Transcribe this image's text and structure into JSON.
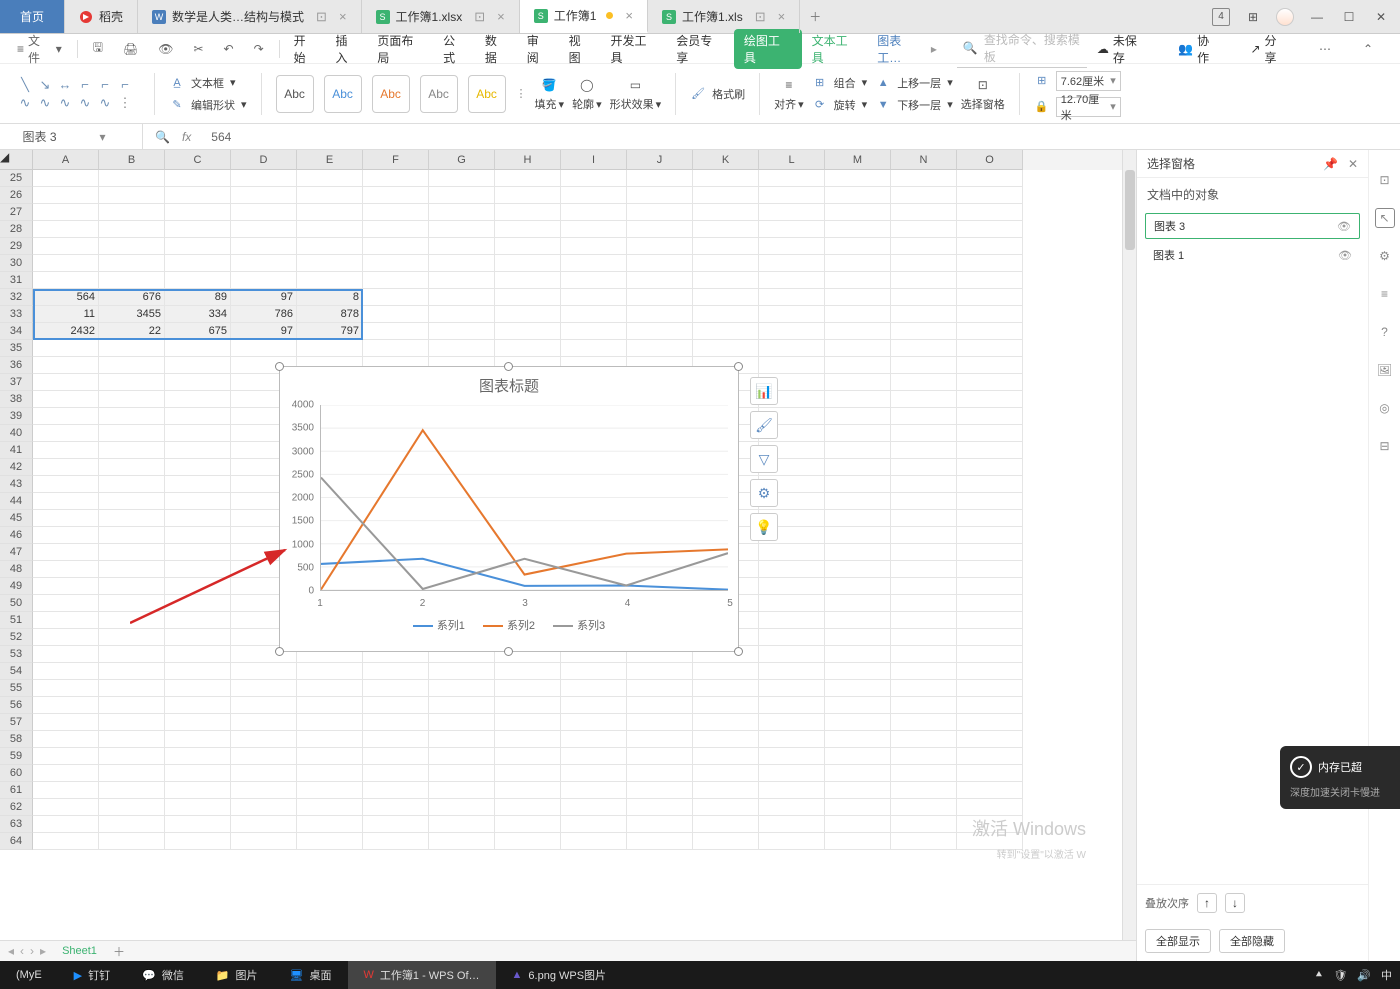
{
  "titlebar": {
    "home": "首页",
    "tabs": [
      {
        "icon": "doke",
        "label": "稻壳",
        "color": "#e53935"
      },
      {
        "icon": "W",
        "label": "数学是人类…结构与模式",
        "color": "#4a7ebb"
      },
      {
        "icon": "S",
        "label": "工作簿1.xlsx",
        "color": "#3cb371"
      },
      {
        "icon": "S",
        "label": "工作簿1",
        "color": "#3cb371",
        "active": true,
        "dirty": true
      },
      {
        "icon": "S",
        "label": "工作簿1.xls",
        "color": "#3cb371"
      }
    ],
    "add": "＋",
    "badge4": "4",
    "grid": "⊞"
  },
  "menubar": {
    "file": "文件",
    "tabs": [
      "开始",
      "插入",
      "页面布局",
      "公式",
      "数据",
      "审阅",
      "视图",
      "开发工具",
      "会员专享"
    ],
    "pillTab": "绘图工具",
    "greenTab": "文本工具",
    "blueTab": "图表工…",
    "search_ph": "查找命令、搜索模板",
    "unsaved": "未保存",
    "collab": "协作",
    "share": "分享"
  },
  "ribbon": {
    "textbox": "文本框",
    "editshape": "编辑形状",
    "abc": "Abc",
    "fill": "填充",
    "outline": "轮廓",
    "fx": "形状效果",
    "formatpaint": "格式刷",
    "align": "对齐",
    "group": "组合",
    "rotate": "旋转",
    "up": "上移一层",
    "down": "下移一层",
    "selectpane": "选择窗格",
    "width": "7.62厘米",
    "height": "12.70厘米",
    "grid_icon": "⊞",
    "lock_icon": "🔒"
  },
  "namebox": {
    "name": "图表 3",
    "fx": "fx",
    "val": "564"
  },
  "columns": [
    "A",
    "B",
    "C",
    "D",
    "E",
    "F",
    "G",
    "H",
    "I",
    "J",
    "K",
    "L",
    "M",
    "N",
    "O"
  ],
  "rows_start": 25,
  "rows_end": 64,
  "cells": {
    "32": {
      "A": "564",
      "B": "676",
      "C": "89",
      "D": "97",
      "E": "8"
    },
    "33": {
      "A": "11",
      "B": "3455",
      "C": "334",
      "D": "786",
      "E": "878"
    },
    "34": {
      "A": "2432",
      "B": "22",
      "C": "675",
      "D": "97",
      "E": "797"
    }
  },
  "chart": {
    "title": "图表标题",
    "legend": [
      "系列1",
      "系列2",
      "系列3"
    ],
    "colors": [
      "#4a90d9",
      "#e6782e",
      "#999999"
    ],
    "sidebtns": [
      "chart-elements",
      "brush",
      "filter",
      "gear",
      "bulb"
    ]
  },
  "chart_data": {
    "type": "line",
    "categories": [
      "1",
      "2",
      "3",
      "4",
      "5"
    ],
    "series": [
      {
        "name": "系列1",
        "values": [
          564,
          676,
          89,
          97,
          8
        ]
      },
      {
        "name": "系列2",
        "values": [
          11,
          3455,
          334,
          786,
          878
        ]
      },
      {
        "name": "系列3",
        "values": [
          2432,
          22,
          675,
          97,
          797
        ]
      }
    ],
    "title": "图表标题",
    "xlabel": "",
    "ylabel": "",
    "ylim": [
      0,
      4000
    ],
    "yticks": [
      0,
      500,
      1000,
      1500,
      2000,
      2500,
      3000,
      3500,
      4000
    ]
  },
  "rightpanel": {
    "title": "选择窗格",
    "sub": "文档中的对象",
    "items": [
      {
        "label": "图表 3",
        "selected": true
      },
      {
        "label": "图表 1"
      }
    ],
    "stack": "叠放次序",
    "showall": "全部显示",
    "hideall": "全部隐藏"
  },
  "watermark": {
    "line1": "激活 Windows",
    "line2": "转到\"设置\"以激活 W"
  },
  "toast": {
    "head": "内存已超",
    "body": "深度加速关闭卡慢进"
  },
  "taskbar": {
    "items": [
      {
        "label": "(MyE"
      },
      {
        "label": "钉钉",
        "icon": "▶",
        "color": "#1e90ff"
      },
      {
        "label": "微信",
        "icon": "💬",
        "color": "#3cb371"
      },
      {
        "label": "图片",
        "icon": "📁",
        "color": "#e0b040"
      },
      {
        "label": "桌面",
        "icon": "🖥",
        "color": "#1e90ff"
      },
      {
        "label": "工作簿1 - WPS Of…",
        "icon": "W",
        "color": "#e53935",
        "active": true
      },
      {
        "label": "6.png  WPS图片",
        "icon": "▲",
        "color": "#6a5acd"
      }
    ],
    "tray": [
      "⯅",
      "🛡",
      "🔊",
      "中"
    ]
  },
  "sheettab": "Sheet1"
}
